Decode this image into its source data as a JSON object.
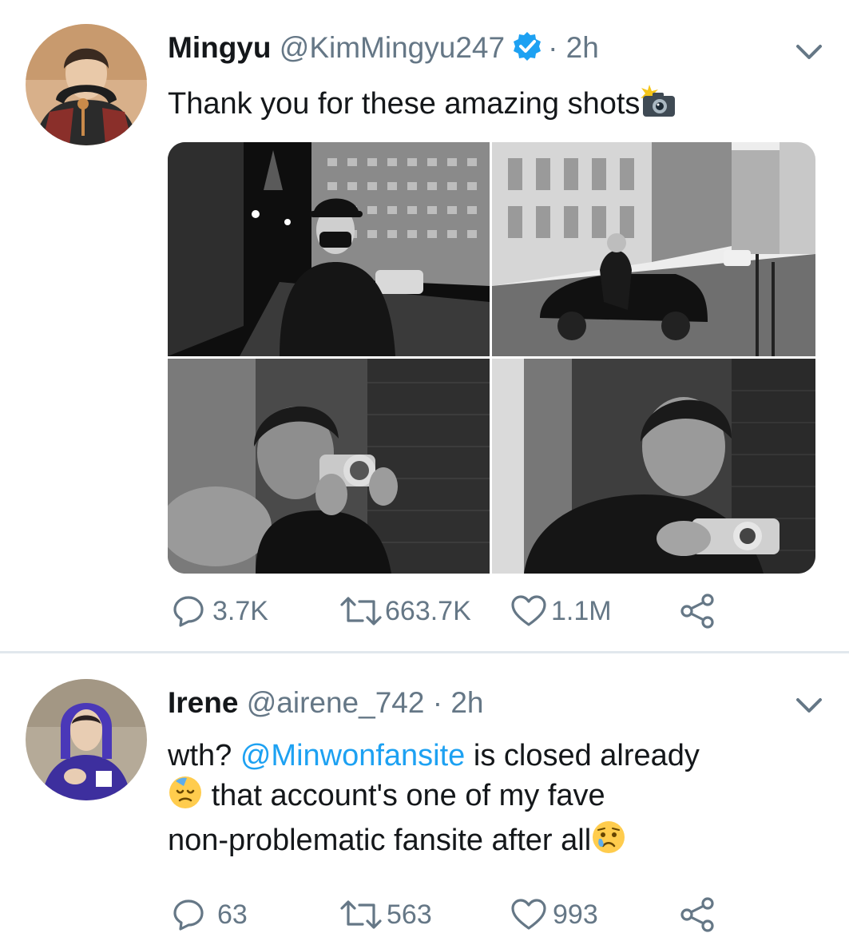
{
  "tweets": [
    {
      "name": "Mingyu",
      "handle": "@KimMingyu247",
      "verified": true,
      "time": "2h",
      "text": "Thank you for these amazing shots",
      "emoji": "camera-flash",
      "media_count": 4,
      "replies": "3.7K",
      "retweets": "663.7K",
      "likes": "1.1M"
    },
    {
      "name": "Irene",
      "handle": "@airene_742",
      "time": "2h",
      "text_before": "wth?",
      "mention": "@Minwonfansite",
      "text_after": "is closed already",
      "text_line2": "that account's one of my fave",
      "text_line3": "non-problematic fansite after all",
      "emojis": [
        "downcast-sweat-face",
        "worried-tear-face"
      ],
      "replies": "63",
      "retweets": "563",
      "likes": "993"
    }
  ],
  "separator": "·",
  "colors": {
    "text": "#14171a",
    "muted": "#657786",
    "link": "#1da1f2",
    "verified": "#1da1f2",
    "divider": "#e1e8ed"
  }
}
